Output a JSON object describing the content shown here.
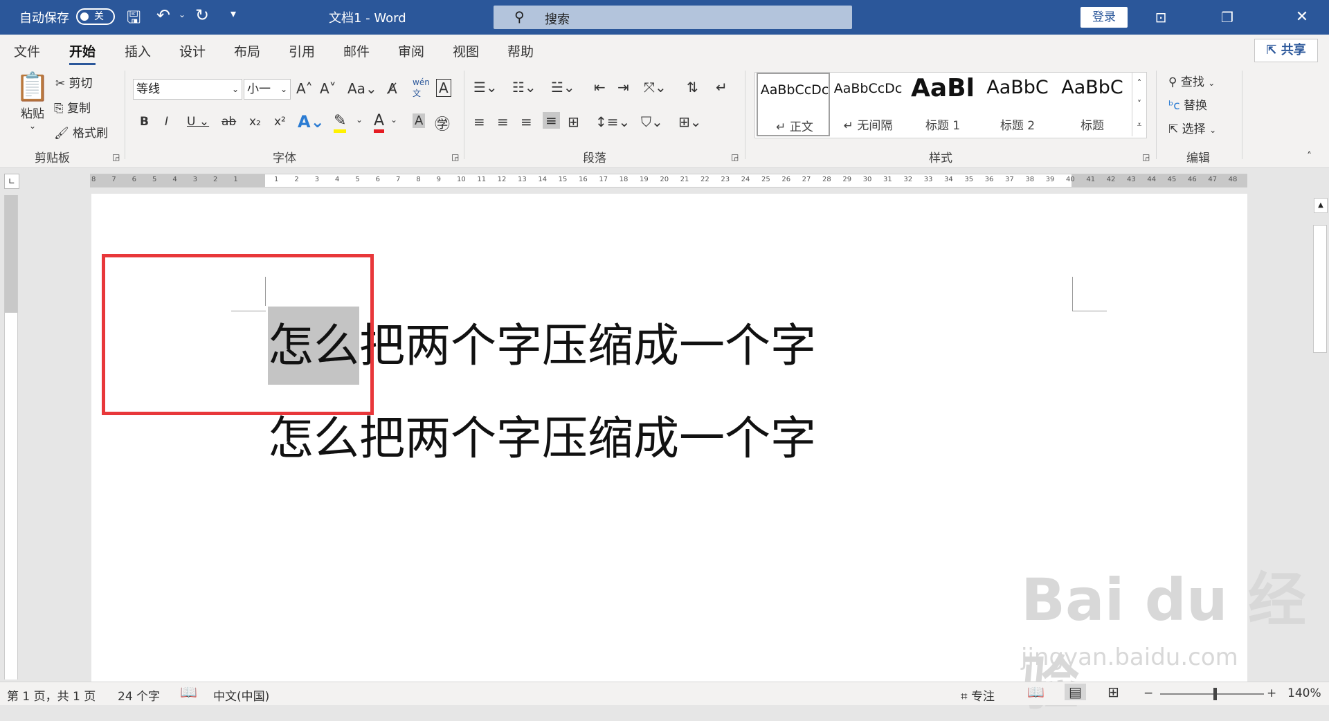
{
  "titlebar": {
    "autosave_label": "自动保存",
    "autosave_state": "关",
    "doc_title": "文档1  -  Word",
    "search_placeholder": "搜索",
    "login_label": "登录"
  },
  "tabs": [
    "文件",
    "开始",
    "插入",
    "设计",
    "布局",
    "引用",
    "邮件",
    "审阅",
    "视图",
    "帮助"
  ],
  "active_tab": "开始",
  "share_label": "共享",
  "clipboard": {
    "paste": "粘贴",
    "cut": "剪切",
    "copy": "复制",
    "format_painter": "格式刷",
    "group": "剪贴板"
  },
  "font": {
    "font_name": "等线",
    "font_size": "小一",
    "group": "字体"
  },
  "paragraph": {
    "group": "段落"
  },
  "styles": {
    "items": [
      {
        "sample": "AaBbCcDc",
        "name": "↵ 正文"
      },
      {
        "sample": "AaBbCcDc",
        "name": "↵ 无间隔"
      },
      {
        "sample": "AaBl",
        "name": "标题 1"
      },
      {
        "sample": "AaBbC",
        "name": "标题 2"
      },
      {
        "sample": "AaBbC",
        "name": "标题"
      }
    ],
    "group": "样式"
  },
  "editing": {
    "find": "查找",
    "replace": "替换",
    "select": "选择",
    "group": "编辑"
  },
  "ruler_ticks": [
    "8",
    "7",
    "6",
    "5",
    "4",
    "3",
    "2",
    "1",
    "",
    "1",
    "2",
    "3",
    "4",
    "5",
    "6",
    "7",
    "8",
    "9",
    "10",
    "11",
    "12",
    "13",
    "14",
    "15",
    "16",
    "17",
    "18",
    "19",
    "20",
    "21",
    "22",
    "23",
    "24",
    "25",
    "26",
    "27",
    "28",
    "29",
    "30",
    "31",
    "32",
    "33",
    "34",
    "35",
    "36",
    "37",
    "38",
    "39",
    "40",
    "41",
    "42",
    "43",
    "44",
    "45",
    "46",
    "47",
    "48"
  ],
  "document": {
    "line1_selected": "怎么",
    "line1_rest": "把两个字压缩成一个字",
    "line2": "怎么把两个字压缩成一个字"
  },
  "status": {
    "page": "第 1 页，共 1 页",
    "words": "24 个字",
    "language": "中文(中国)",
    "focus": "专注",
    "zoom": "140%"
  },
  "watermark": {
    "brand": "Bai du 经验",
    "url": "jingyan.baidu.com"
  },
  "colors": {
    "title_bar": "#2b579a",
    "highlight_box": "#e8373a",
    "selection": "#c4c4c4"
  }
}
